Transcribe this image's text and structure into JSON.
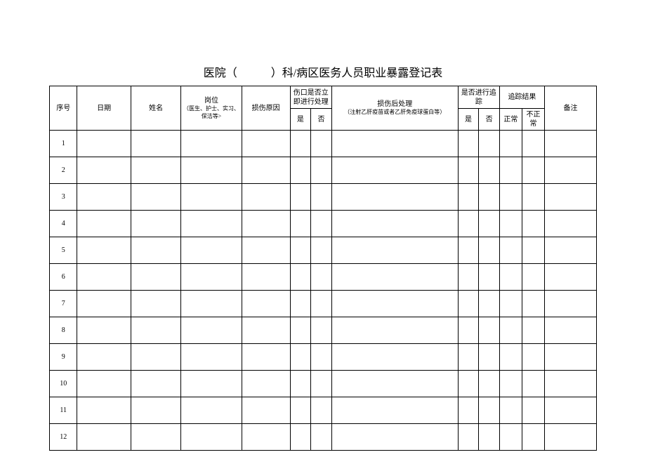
{
  "title": "医院（　　　）科/病区医务人员职业暴露登记表",
  "headers": {
    "seq": "序号",
    "date": "日期",
    "name": "姓名",
    "post": "岗位",
    "post_sub": "（医生、护士、实习、保洁等>",
    "reason": "损伤原因",
    "wound": "伤口是否立即进行处理",
    "yes": "是",
    "no": "否",
    "treat": "损伤后处理",
    "treat_sub": "（注射乙肝疫苗或者乙肝免疫球蛋白等）",
    "track": "是否进行追踪",
    "result": "追踪结果",
    "normal": "正常",
    "abnormal": "不正常",
    "remark": "备注"
  },
  "rows": [
    {
      "seq": "1"
    },
    {
      "seq": "2"
    },
    {
      "seq": "3"
    },
    {
      "seq": "4"
    },
    {
      "seq": "5"
    },
    {
      "seq": "6"
    },
    {
      "seq": "7"
    },
    {
      "seq": "8"
    },
    {
      "seq": "9"
    },
    {
      "seq": "10"
    },
    {
      "seq": "11"
    },
    {
      "seq": "12"
    }
  ]
}
